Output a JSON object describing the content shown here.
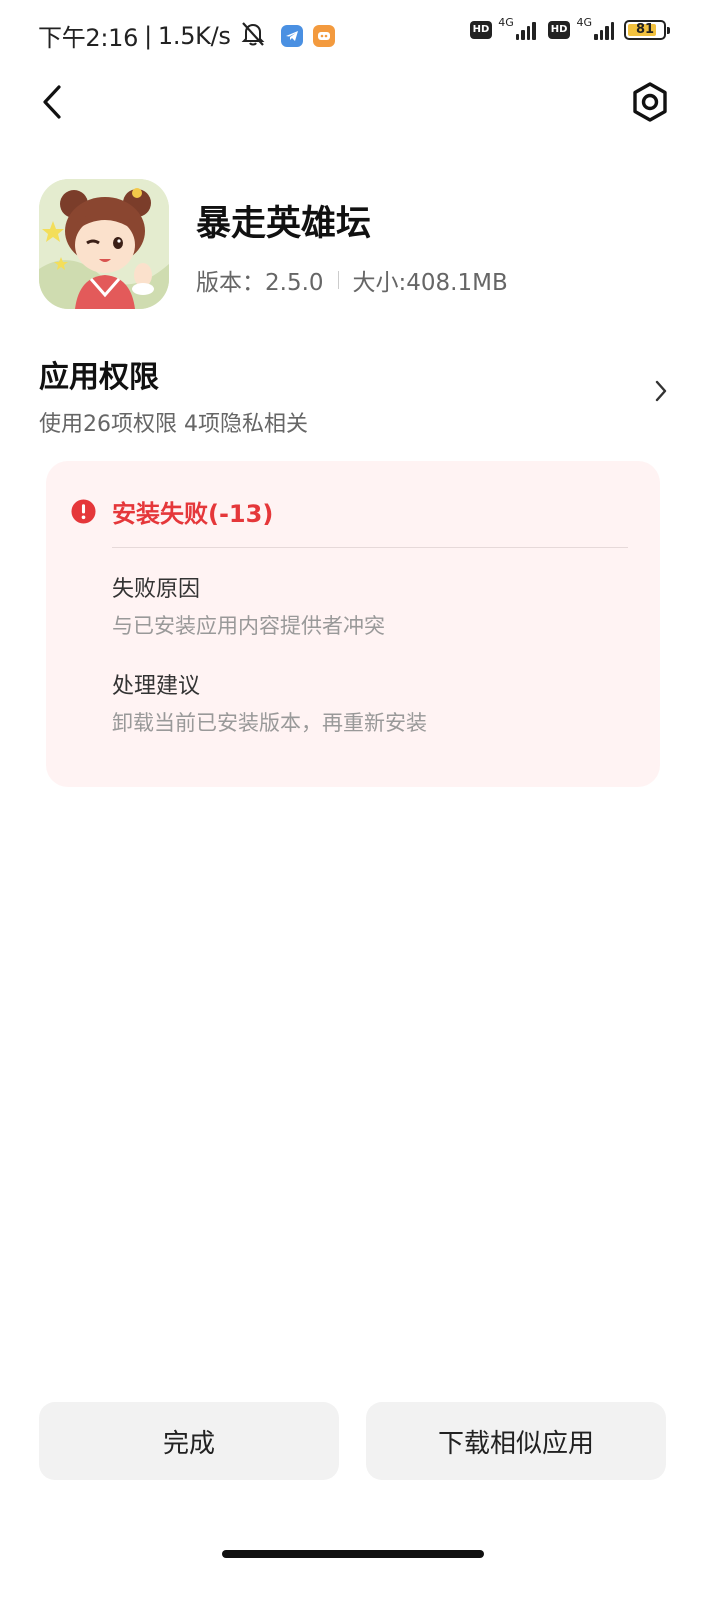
{
  "status_bar": {
    "time": "下午2:16",
    "speed": "1.5K/s",
    "separator": "|",
    "icons": [
      "mute-bell-icon",
      "telegram-icon",
      "game-app-icon"
    ],
    "hd_label_1": "HD",
    "hd_label_2": "HD",
    "net_label_1": "4G",
    "net_label_2": "4G",
    "battery_level": "81",
    "battery_fraction": 0.81,
    "battery_color": "#f2c13e"
  },
  "nav": {
    "back_icon": "chevron-left-icon",
    "settings_icon": "hexagon-settings-icon"
  },
  "app": {
    "name": "暴走英雄坛",
    "version_text": "版本：2.5.0",
    "size_text": "大小:408.1MB"
  },
  "permissions": {
    "title": "应用权限",
    "subtitle": "使用26项权限 4项隐私相关"
  },
  "error": {
    "title": "安装失败(-13)",
    "color": "#e5373a",
    "reason_label": "失败原因",
    "reason_value": "与已安装应用内容提供者冲突",
    "suggestion_label": "处理建议",
    "suggestion_value": "卸载当前已安装版本，再重新安装"
  },
  "buttons": {
    "done": "完成",
    "similar": "下载相似应用"
  }
}
